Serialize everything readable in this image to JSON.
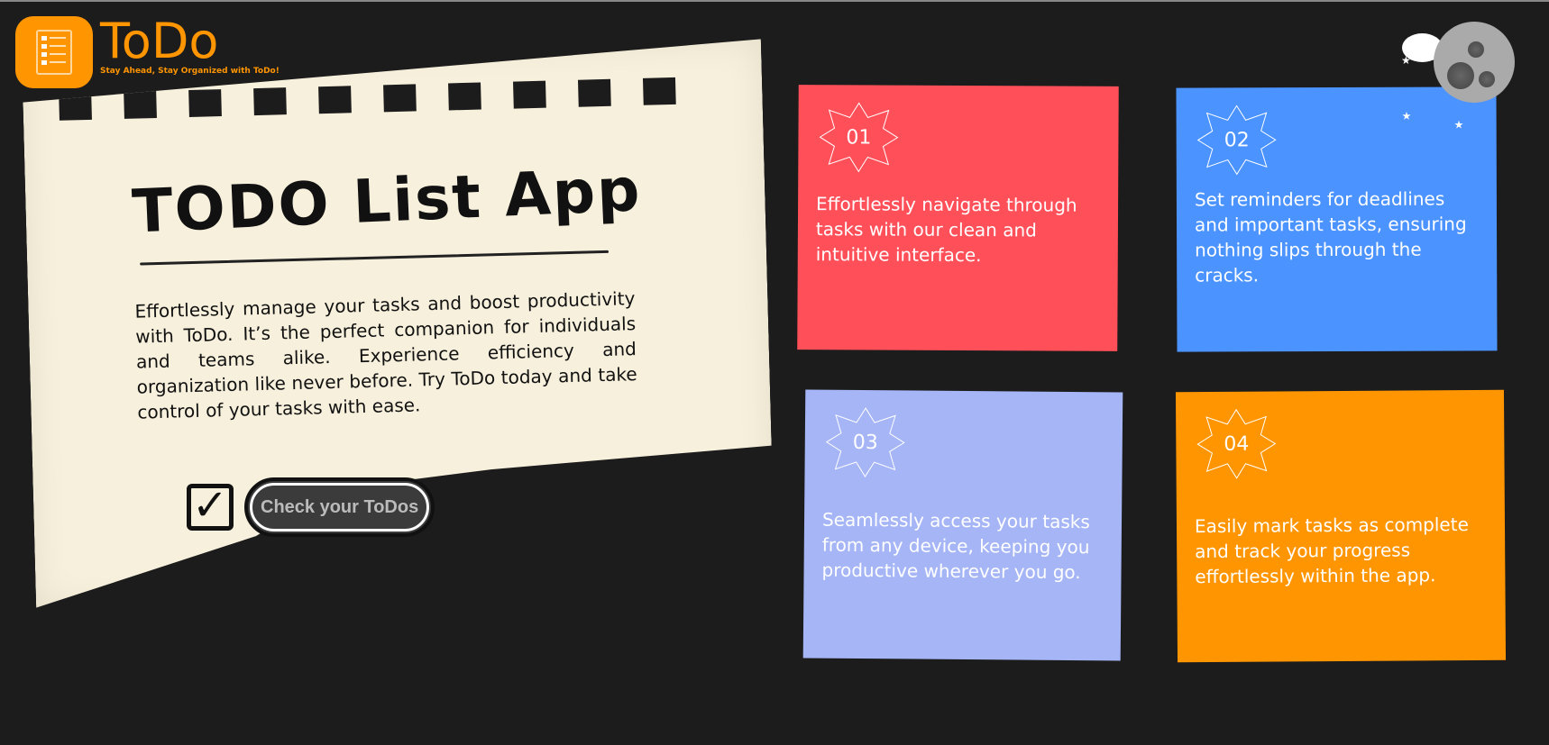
{
  "brand": {
    "name": "ToDo",
    "tagline": "Stay Ahead, Stay Organized with ToDo!",
    "color": "#ff9500"
  },
  "hero": {
    "title": "TODO List App",
    "description": "Effortlessly manage your tasks and boost productivity with ToDo. It’s the perfect companion for individuals and teams alike. Experience efficiency and organization like never before. Try ToDo today and take control of your tasks with ease.",
    "cta_label": "Check your ToDos"
  },
  "features": [
    {
      "number": "01",
      "text": "Effortlessly navigate through tasks with our clean and intuitive interface.",
      "color": "#ff4f58"
    },
    {
      "number": "02",
      "text": "Set reminders for deadlines and important tasks, ensuring nothing slips through the cracks.",
      "color": "#4b93ff"
    },
    {
      "number": "03",
      "text": "Seamlessly access your tasks from any device, keeping you productive wherever you go.",
      "color": "#a5b5f6"
    },
    {
      "number": "04",
      "text": "Easily mark tasks as complete and track your progress effortlessly within the app.",
      "color": "#ff9500"
    }
  ],
  "icons": {
    "logo": "checklist-icon",
    "theme": "moon-icon",
    "cta": "checkbox-icon"
  }
}
